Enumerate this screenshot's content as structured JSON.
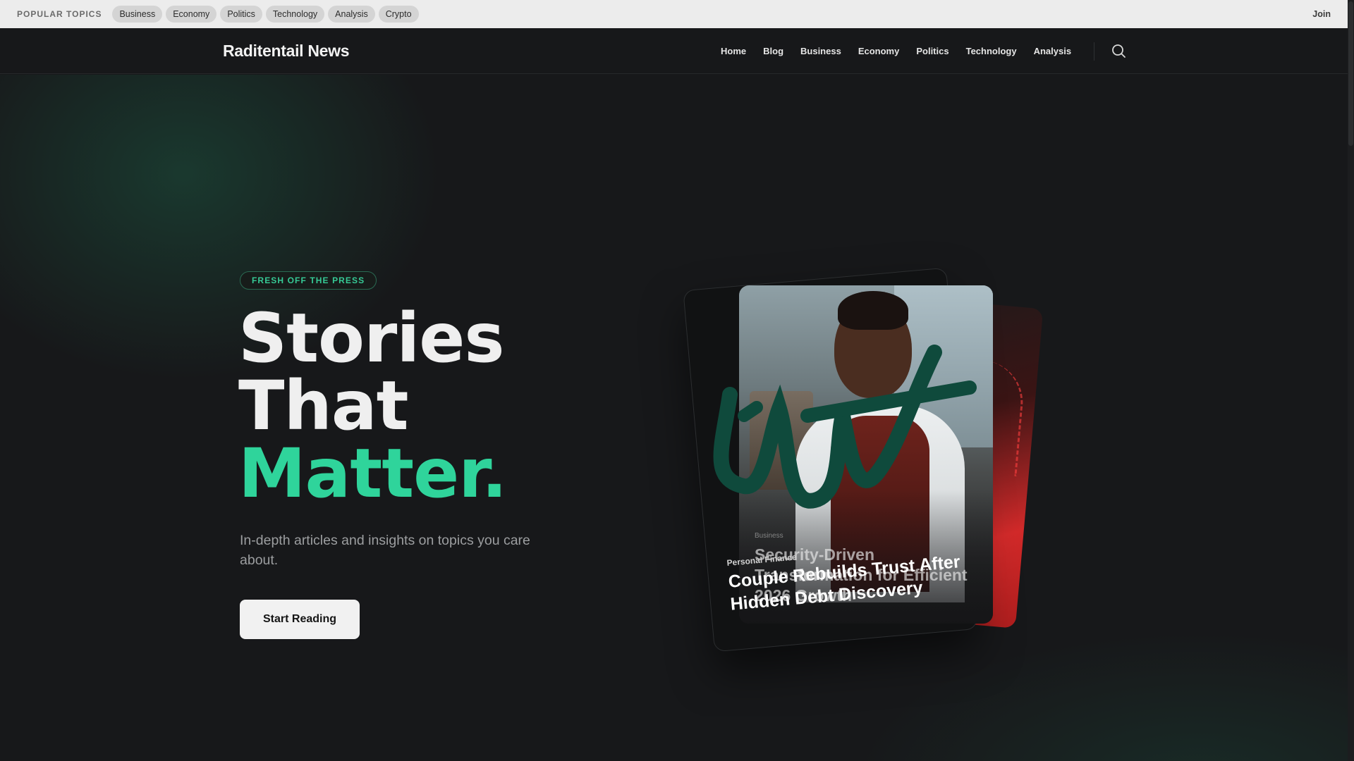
{
  "topbar": {
    "label": "POPULAR TOPICS",
    "pills": [
      "Business",
      "Economy",
      "Politics",
      "Technology",
      "Analysis",
      "Crypto"
    ],
    "join": "Join"
  },
  "nav": {
    "brand": "Raditentail News",
    "links": [
      "Home",
      "Blog",
      "Business",
      "Economy",
      "Politics",
      "Technology",
      "Analysis"
    ],
    "search_icon": "search-icon"
  },
  "hero": {
    "badge": "FRESH OFF THE PRESS",
    "headline_line1": "Stories",
    "headline_line2": "That",
    "headline_accent": "Matter.",
    "subtitle": "In-depth articles and insights on topics you care about.",
    "cta": "Start Reading",
    "accent_color": "#2fd49b"
  },
  "cards": {
    "front": {
      "tag": "Business",
      "title": "Security-Driven Transformation for Efficient 2026 Growth"
    },
    "mid": {
      "tag": "Personal Finance",
      "title": "Couple Rebuilds Trust After Hidden Debt Discovery"
    }
  }
}
